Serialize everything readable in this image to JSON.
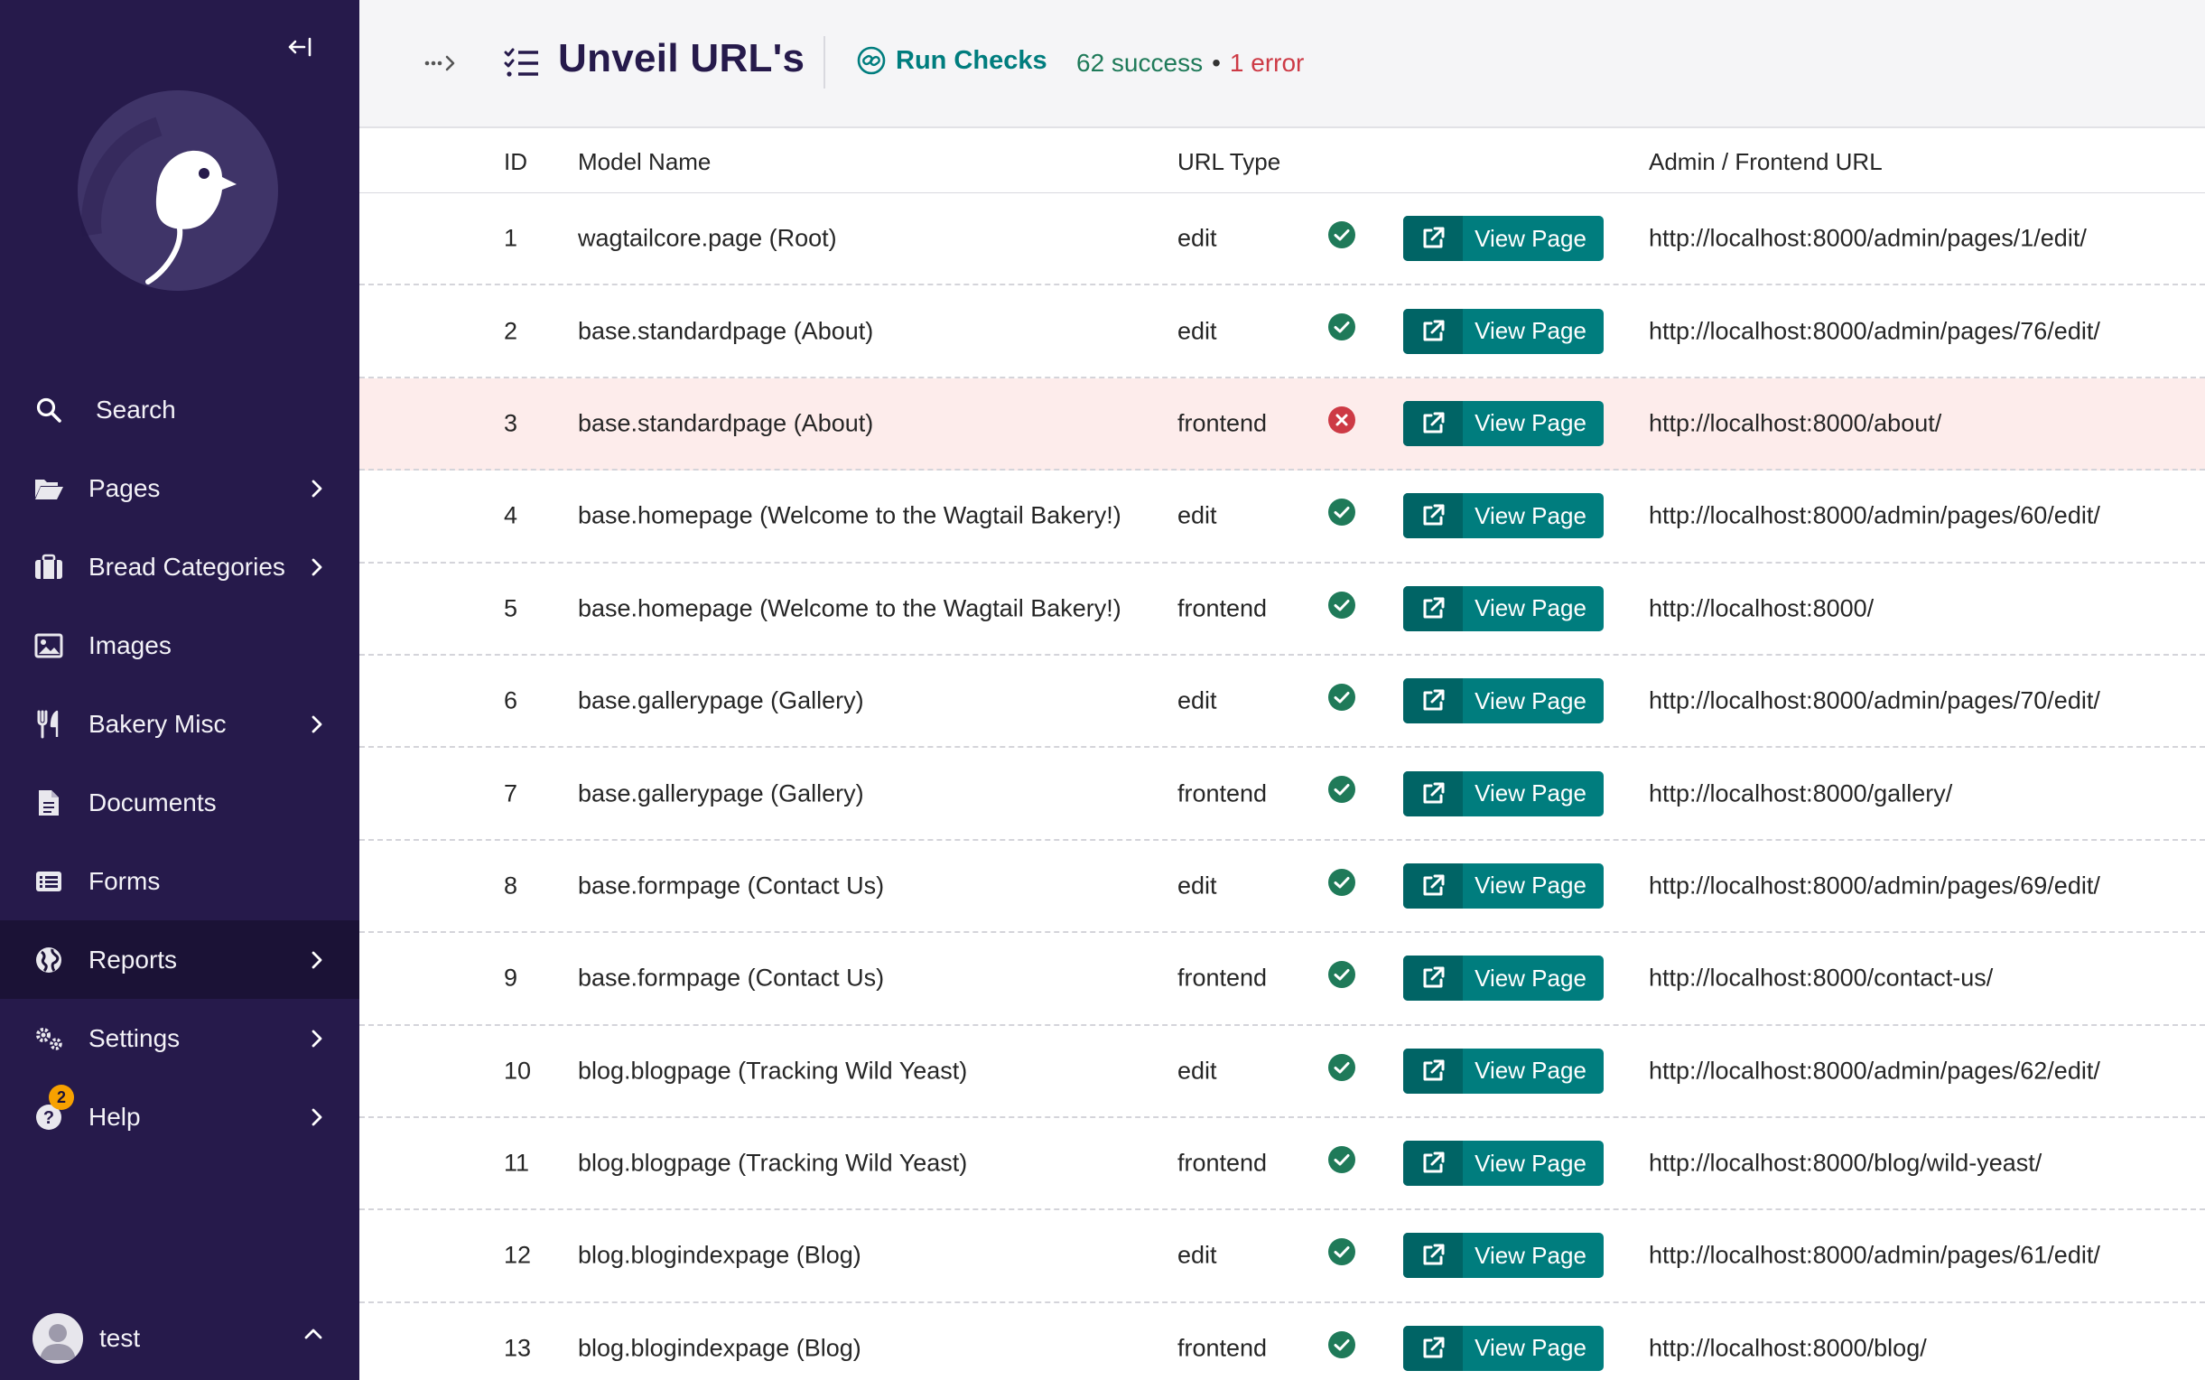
{
  "app": {
    "title": "Unveil URL's",
    "run_checks_label": "Run Checks",
    "success_text": "62 success",
    "separator": "•",
    "error_text": "1 error",
    "colors": {
      "sidebar": "#261a4b",
      "accent": "#007d7e",
      "success": "#1f7a59",
      "error": "#cd3a45"
    }
  },
  "sidebar": {
    "items": [
      {
        "label": "Search",
        "icon": "search-icon",
        "has_submenu": false
      },
      {
        "label": "Pages",
        "icon": "folder-open-icon",
        "has_submenu": true
      },
      {
        "label": "Bread Categories",
        "icon": "suitcase-icon",
        "has_submenu": true
      },
      {
        "label": "Images",
        "icon": "image-icon",
        "has_submenu": false
      },
      {
        "label": "Bakery Misc",
        "icon": "utensils-icon",
        "has_submenu": true
      },
      {
        "label": "Documents",
        "icon": "document-icon",
        "has_submenu": false
      },
      {
        "label": "Forms",
        "icon": "list-icon",
        "has_submenu": false
      },
      {
        "label": "Reports",
        "icon": "globe-icon",
        "has_submenu": true,
        "active": true
      },
      {
        "label": "Settings",
        "icon": "cogs-icon",
        "has_submenu": true
      },
      {
        "label": "Help",
        "icon": "help-icon",
        "has_submenu": true,
        "badge": "2"
      }
    ],
    "user": {
      "name": "test"
    }
  },
  "table": {
    "headers": {
      "id": "ID",
      "model": "Model Name",
      "type": "URL Type",
      "url": "Admin / Frontend URL"
    },
    "button_label": "View Page",
    "rows": [
      {
        "id": "1",
        "model": "wagtailcore.page (Root)",
        "type": "edit",
        "status": "success",
        "url": "http://localhost:8000/admin/pages/1/edit/"
      },
      {
        "id": "2",
        "model": "base.standardpage (About)",
        "type": "edit",
        "status": "success",
        "url": "http://localhost:8000/admin/pages/76/edit/"
      },
      {
        "id": "3",
        "model": "base.standardpage (About)",
        "type": "frontend",
        "status": "error",
        "url": "http://localhost:8000/about/"
      },
      {
        "id": "4",
        "model": "base.homepage (Welcome to the Wagtail Bakery!)",
        "type": "edit",
        "status": "success",
        "url": "http://localhost:8000/admin/pages/60/edit/"
      },
      {
        "id": "5",
        "model": "base.homepage (Welcome to the Wagtail Bakery!)",
        "type": "frontend",
        "status": "success",
        "url": "http://localhost:8000/"
      },
      {
        "id": "6",
        "model": "base.gallerypage (Gallery)",
        "type": "edit",
        "status": "success",
        "url": "http://localhost:8000/admin/pages/70/edit/"
      },
      {
        "id": "7",
        "model": "base.gallerypage (Gallery)",
        "type": "frontend",
        "status": "success",
        "url": "http://localhost:8000/gallery/"
      },
      {
        "id": "8",
        "model": "base.formpage (Contact Us)",
        "type": "edit",
        "status": "success",
        "url": "http://localhost:8000/admin/pages/69/edit/"
      },
      {
        "id": "9",
        "model": "base.formpage (Contact Us)",
        "type": "frontend",
        "status": "success",
        "url": "http://localhost:8000/contact-us/"
      },
      {
        "id": "10",
        "model": "blog.blogpage (Tracking Wild Yeast)",
        "type": "edit",
        "status": "success",
        "url": "http://localhost:8000/admin/pages/62/edit/"
      },
      {
        "id": "11",
        "model": "blog.blogpage (Tracking Wild Yeast)",
        "type": "frontend",
        "status": "success",
        "url": "http://localhost:8000/blog/wild-yeast/"
      },
      {
        "id": "12",
        "model": "blog.blogindexpage (Blog)",
        "type": "edit",
        "status": "success",
        "url": "http://localhost:8000/admin/pages/61/edit/"
      },
      {
        "id": "13",
        "model": "blog.blogindexpage (Blog)",
        "type": "frontend",
        "status": "success",
        "url": "http://localhost:8000/blog/"
      }
    ]
  }
}
